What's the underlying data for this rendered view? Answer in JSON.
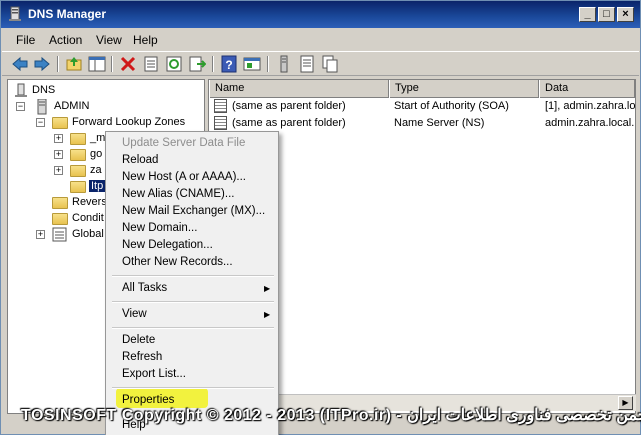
{
  "window": {
    "title": "DNS Manager",
    "controls": {
      "minimize": "_",
      "maximize": "□",
      "close": "×"
    }
  },
  "menubar": {
    "items": [
      {
        "label": "File"
      },
      {
        "label": "Action"
      },
      {
        "label": "View"
      },
      {
        "label": "Help"
      }
    ]
  },
  "toolbar": {
    "icons": [
      "back-arrow-icon",
      "forward-arrow-icon",
      "up-folder-icon",
      "show-hide-tree-icon",
      "delete-icon",
      "properties-icon",
      "refresh-icon",
      "export-list-icon",
      "help-icon",
      "mmc-icon",
      "server-icon",
      "list-icon",
      "copy-icon"
    ]
  },
  "tree": {
    "items": [
      {
        "label": "DNS"
      },
      {
        "label": "ADMIN"
      },
      {
        "label": "Forward Lookup Zones"
      },
      {
        "label": "_m"
      },
      {
        "label": "go"
      },
      {
        "label": "za"
      },
      {
        "label": "Itp"
      },
      {
        "label": "Revers"
      },
      {
        "label": "Condit"
      },
      {
        "label": "Global"
      }
    ]
  },
  "list": {
    "columns": [
      "Name",
      "Type",
      "Data"
    ],
    "rows": [
      {
        "name": "(same as parent folder)",
        "type": "Start of Authority (SOA)",
        "data": "[1], admin.zahra.lo"
      },
      {
        "name": "(same as parent folder)",
        "type": "Name Server (NS)",
        "data": "admin.zahra.local."
      }
    ]
  },
  "context_menu": {
    "items": [
      {
        "label": "Update Server Data File",
        "disabled": true
      },
      {
        "label": "Reload"
      },
      {
        "label": "New Host (A or AAAA)..."
      },
      {
        "label": "New Alias (CNAME)..."
      },
      {
        "label": "New Mail Exchanger (MX)..."
      },
      {
        "label": "New Domain..."
      },
      {
        "label": "New Delegation..."
      },
      {
        "label": "Other New Records..."
      },
      {
        "label": "All Tasks"
      },
      {
        "label": "View"
      },
      {
        "label": "Delete"
      },
      {
        "label": "Refresh"
      },
      {
        "label": "Export List..."
      },
      {
        "label": "Properties"
      },
      {
        "label": "Help"
      }
    ],
    "highlight_color": "#f2f22a"
  },
  "watermark": {
    "text": "TOSINSOFT  Copyright © 2012 - 2013 (ITPro.ir) - انجمن تخصصی فناوری اطلاعات ایران"
  },
  "colors": {
    "titlebar": "#0a246a",
    "selection": "#0a246a",
    "window_bg": "#d4d0c8"
  }
}
